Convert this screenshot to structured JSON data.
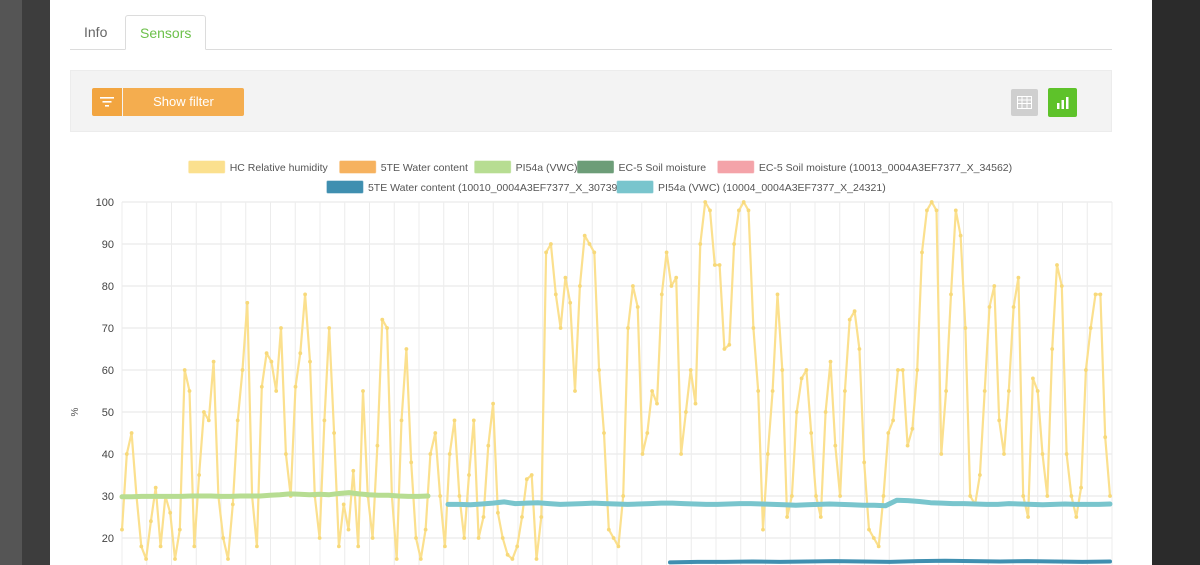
{
  "tabs": {
    "info": "Info",
    "sensors": "Sensors"
  },
  "toolbar": {
    "filter_label": "Show filter"
  },
  "icons": {
    "filter": "filter-icon",
    "table_view": "table-icon",
    "chart_view": "bar-chart-icon"
  },
  "colors": {
    "accent_green": "#5ec22a",
    "filter_orange": "#f4ad4f"
  },
  "chart_data": {
    "type": "line",
    "ylabel": "%",
    "ylim": [
      15,
      100
    ],
    "yticks": [
      20,
      30,
      40,
      50,
      60,
      70,
      80,
      90,
      100
    ],
    "grid": true,
    "legend_placement": "top-center",
    "series": [
      {
        "name": "HC Relative humidity",
        "color": "#fbe08e",
        "values": [
          22,
          40,
          45,
          30,
          18,
          15,
          24,
          32,
          18,
          30,
          26,
          15,
          22,
          60,
          55,
          18,
          35,
          50,
          48,
          62,
          30,
          20,
          15,
          28,
          48,
          60,
          76,
          30,
          18,
          56,
          64,
          62,
          55,
          70,
          40,
          30,
          56,
          64,
          78,
          62,
          30,
          20,
          48,
          70,
          45,
          18,
          28,
          22,
          36,
          18,
          55,
          30,
          20,
          42,
          72,
          70,
          30,
          15,
          48,
          65,
          38,
          20,
          15,
          22,
          40,
          45,
          30,
          18,
          40,
          48,
          30,
          20,
          35,
          48,
          20,
          25,
          42,
          52,
          26,
          20,
          16,
          15,
          18,
          25,
          34,
          35,
          15,
          25,
          88,
          90,
          78,
          70,
          82,
          76,
          55,
          80,
          92,
          90,
          88,
          60,
          45,
          22,
          20,
          18,
          30,
          70,
          80,
          75,
          40,
          45,
          55,
          52,
          78,
          88,
          80,
          82,
          40,
          50,
          60,
          52,
          90,
          100,
          98,
          85,
          85,
          65,
          66,
          90,
          98,
          100,
          98,
          70,
          55,
          22,
          40,
          55,
          78,
          60,
          25,
          30,
          50,
          58,
          60,
          45,
          30,
          25,
          50,
          62,
          42,
          30,
          55,
          72,
          74,
          65,
          38,
          22,
          20,
          18,
          30,
          45,
          48,
          60,
          60,
          42,
          46,
          60,
          88,
          98,
          100,
          98,
          40,
          55,
          78,
          98,
          92,
          70,
          30,
          28,
          35,
          55,
          75,
          80,
          48,
          40,
          55,
          75,
          82,
          30,
          25,
          58,
          55,
          40,
          30,
          65,
          85,
          80,
          40,
          30,
          25,
          32,
          60,
          70,
          78,
          78,
          44,
          30
        ]
      },
      {
        "name": "5TE Water content",
        "color": "#f6b25f",
        "values": []
      },
      {
        "name": "PI54a (VWC)",
        "color": "#b7dd92",
        "values": [
          29.8,
          29.8,
          29.9,
          29.9,
          29.9,
          29.9,
          29.9,
          30.0,
          30.0,
          30.0,
          29.9,
          29.9,
          30.0,
          30.0,
          30.0,
          30.2,
          30.3,
          30.5,
          30.4,
          30.3,
          30.4,
          30.3,
          30.6,
          30.8,
          30.5,
          30.3,
          30.2,
          30.2,
          30.0,
          29.9,
          29.9,
          30.0
        ]
      },
      {
        "name": "EC-5 Soil moisture",
        "color": "#6d9d78",
        "values": []
      },
      {
        "name": "EC-5 Soil moisture (10013_0004A3EF7377_X_34562)",
        "color": "#f4a3a9",
        "values": []
      },
      {
        "name": "5TE Water content (10010_0004A3EF7377_X_30739)",
        "color": "#3f8fb0",
        "values": [
          14.2,
          14.3,
          14.3,
          14.4,
          14.3,
          14.4,
          14.5,
          14.4,
          14.3,
          14.5,
          14.6,
          14.5,
          14.4,
          14.5,
          14.4,
          14.3,
          14.4
        ]
      },
      {
        "name": "PI54a (VWC) (10004_0004A3EF7377_X_24321)",
        "color": "#79c5cd",
        "values": [
          28.0,
          28.0,
          27.9,
          28.1,
          28.3,
          28.6,
          28.2,
          28.3,
          28.4,
          28.2,
          28.0,
          28.1,
          28.2,
          28.3,
          28.2,
          28.1,
          28.0,
          28.1,
          28.2,
          28.3,
          28.3,
          28.2,
          28.1,
          28.0,
          28.0,
          28.1,
          28.2,
          28.2,
          28.1,
          28.0,
          27.9,
          27.8,
          27.9,
          28.0,
          28.1,
          28.0,
          27.9,
          27.8,
          27.8,
          27.7,
          29.0,
          28.9,
          28.7,
          28.4,
          28.3,
          28.2,
          28.2,
          28.1,
          28.0,
          28.0,
          28.2,
          28.1,
          28.0,
          27.9,
          28.0,
          28.1,
          28.0,
          28.0,
          28.0,
          28.1
        ]
      }
    ]
  }
}
